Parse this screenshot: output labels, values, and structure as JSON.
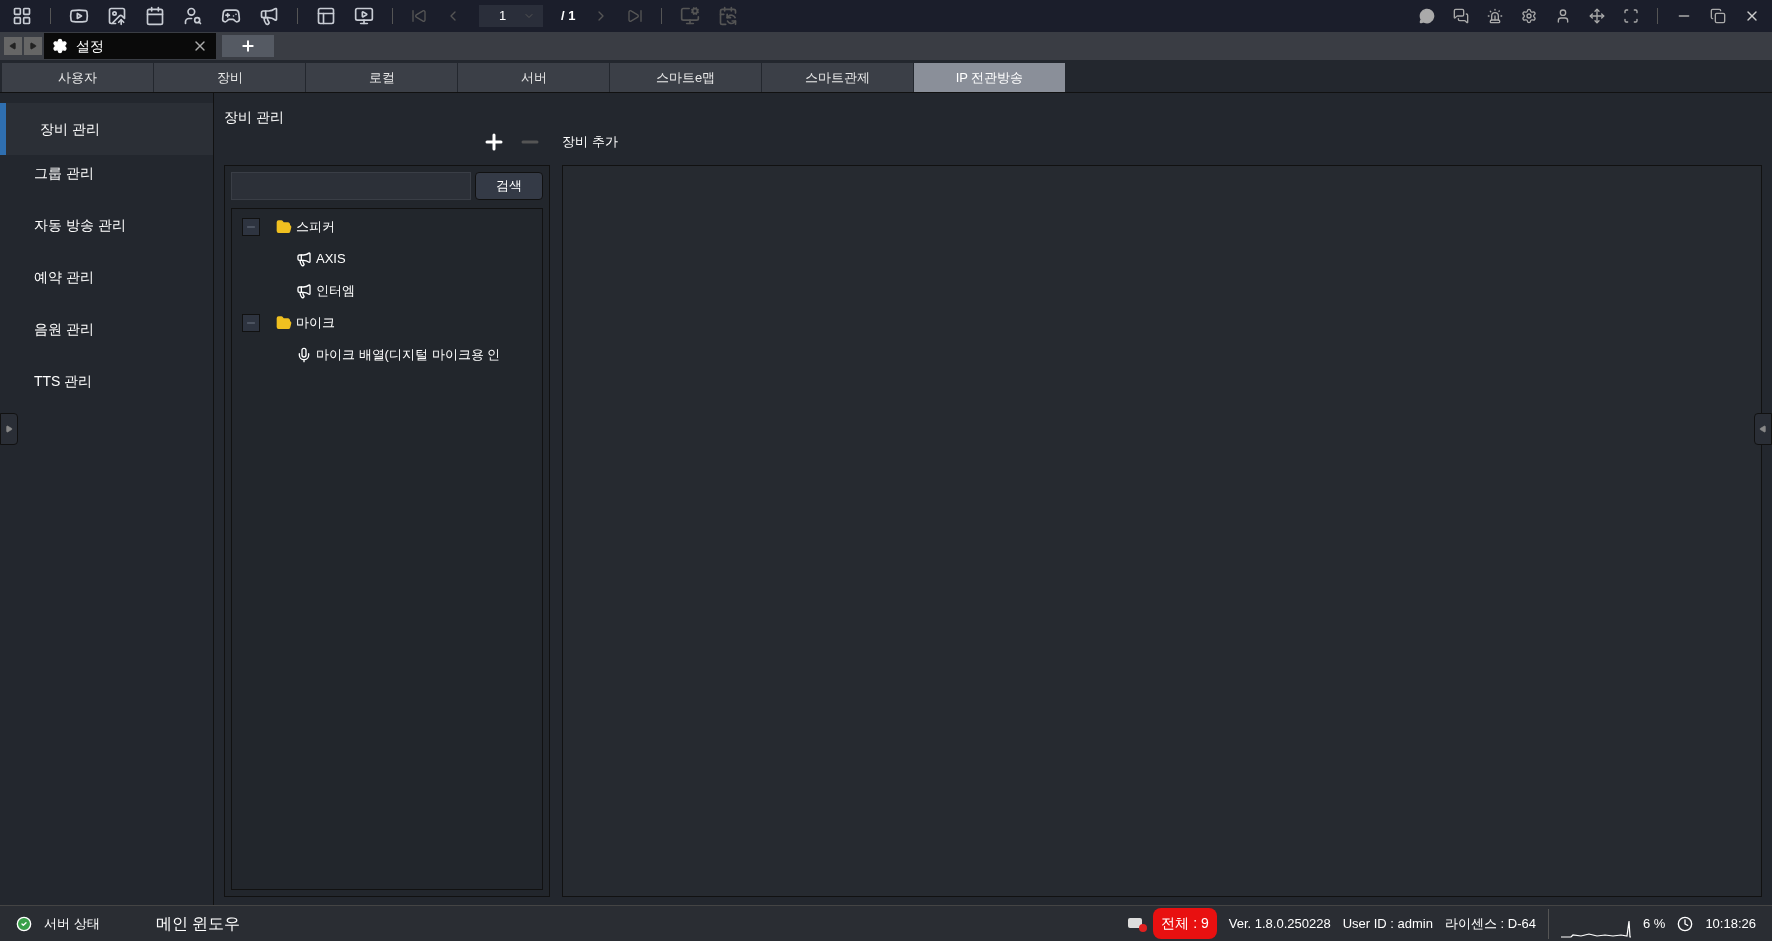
{
  "toolbar": {
    "page": "1",
    "total": "/ 1"
  },
  "doc_tab": {
    "label": "설정"
  },
  "tabs": [
    {
      "label": "사용자",
      "selected": false
    },
    {
      "label": "장비",
      "selected": false
    },
    {
      "label": "로컬",
      "selected": false
    },
    {
      "label": "서버",
      "selected": false
    },
    {
      "label": "스마트e맵",
      "selected": false
    },
    {
      "label": "스마트관제",
      "selected": false
    },
    {
      "label": "IP 전관방송",
      "selected": true
    }
  ],
  "sidebar": {
    "items": [
      {
        "label": "장비 관리",
        "selected": true
      },
      {
        "label": "그룹 관리",
        "selected": false
      },
      {
        "label": "자동 방송 관리",
        "selected": false
      },
      {
        "label": "예약 관리",
        "selected": false
      },
      {
        "label": "음원 관리",
        "selected": false
      },
      {
        "label": "TTS 관리",
        "selected": false
      }
    ]
  },
  "panel": {
    "title": "장비 관리",
    "remove_disabled": true,
    "detail_title": "장비 추가",
    "search_button": "검색",
    "tree": [
      {
        "kind": "folder",
        "label": "스피커",
        "expanded": true,
        "children": [
          {
            "kind": "speaker",
            "label": "AXIS"
          },
          {
            "kind": "speaker",
            "label": "인터엠"
          }
        ]
      },
      {
        "kind": "folder",
        "label": "마이크",
        "expanded": true,
        "children": [
          {
            "kind": "mic",
            "label": "마이크 배열(디지털 마이크용 인"
          }
        ]
      }
    ]
  },
  "status_bar": {
    "server_status": "서버 상태",
    "window_name": "메인 윈도우",
    "alert": "전체 : 9",
    "version": "Ver. 1.8.0.250228",
    "user": "User ID : admin",
    "license": "라이센스 : D-64",
    "cpu": "6 %",
    "time": "10:18:26"
  }
}
